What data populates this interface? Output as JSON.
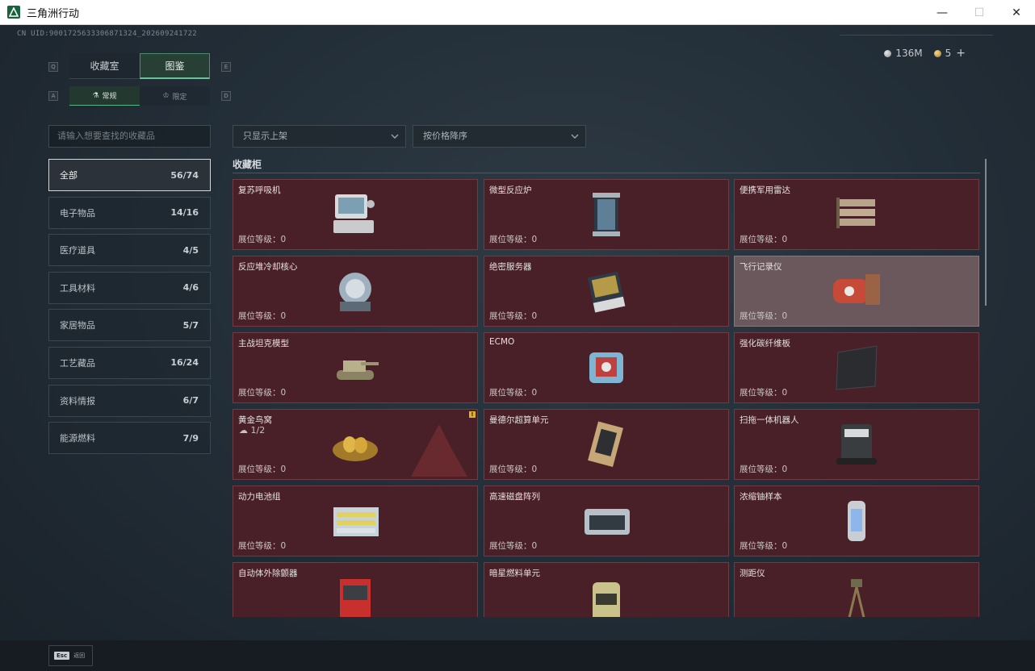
{
  "window": {
    "title": "三角洲行动"
  },
  "header": {
    "uid": "CN UID:9001725633306871324_202609241722",
    "currency": [
      {
        "icon": "silver-coin-icon",
        "value": "136M",
        "color": "#b9bec3"
      },
      {
        "icon": "gold-coin-icon",
        "value": "5",
        "color": "#d4b063"
      }
    ],
    "add_label": "+"
  },
  "keyhints": {
    "q": "Q",
    "e": "E",
    "a": "A",
    "d": "D"
  },
  "tabs": [
    {
      "label": "收藏室",
      "active": false
    },
    {
      "label": "图鉴",
      "active": true
    }
  ],
  "subtabs": [
    {
      "label": "常规",
      "active": true,
      "icon": "flask-icon"
    },
    {
      "label": "限定",
      "active": false,
      "icon": "crown-icon"
    }
  ],
  "search": {
    "placeholder": "请输入想要查找的收藏品"
  },
  "categories": [
    {
      "label": "全部",
      "count": "56/74",
      "active": true
    },
    {
      "label": "电子物品",
      "count": "14/16"
    },
    {
      "label": "医疗道具",
      "count": "4/5"
    },
    {
      "label": "工具材料",
      "count": "4/6"
    },
    {
      "label": "家居物品",
      "count": "5/7"
    },
    {
      "label": "工艺藏品",
      "count": "16/24"
    },
    {
      "label": "资料情报",
      "count": "6/7"
    },
    {
      "label": "能源燃料",
      "count": "7/9"
    }
  ],
  "filters": {
    "shelf": "只显示上架",
    "sort": "按价格降序"
  },
  "section": {
    "title": "收藏柜"
  },
  "items": [
    {
      "name": "复苏呼吸机",
      "level": "展位等级：0",
      "icon": "ventilator-icon"
    },
    {
      "name": "微型反应炉",
      "level": "展位等级：0",
      "icon": "reactor-icon"
    },
    {
      "name": "便携军用雷达",
      "level": "展位等级：0",
      "icon": "radar-icon"
    },
    {
      "name": "反应堆冷却核心",
      "level": "展位等级：0",
      "icon": "cooling-core-icon"
    },
    {
      "name": "绝密服务器",
      "level": "展位等级：0",
      "icon": "server-icon"
    },
    {
      "name": "飞行记录仪",
      "level": "展位等级：0",
      "icon": "flight-recorder-icon",
      "grey": true
    },
    {
      "name": "主战坦克模型",
      "level": "展位等级：0",
      "icon": "tank-model-icon"
    },
    {
      "name": "ECMO",
      "level": "展位等级：0",
      "icon": "ecmo-icon"
    },
    {
      "name": "强化碳纤维板",
      "level": "展位等级：0",
      "icon": "carbon-plate-icon"
    },
    {
      "name": "黄金鸟窝",
      "level": "展位等级：0",
      "icon": "golden-nest-icon",
      "extra": "1/2",
      "warn": "!"
    },
    {
      "name": "曼德尔超算单元",
      "level": "展位等级：0",
      "icon": "supercomputer-icon"
    },
    {
      "name": "扫拖一体机器人",
      "level": "展位等级：0",
      "icon": "mop-robot-icon"
    },
    {
      "name": "动力电池组",
      "level": "展位等级：0",
      "icon": "battery-pack-icon"
    },
    {
      "name": "高速磁盘阵列",
      "level": "展位等级：0",
      "icon": "disk-array-icon"
    },
    {
      "name": "浓缩铀样本",
      "level": "展位等级：0",
      "icon": "uranium-sample-icon"
    },
    {
      "name": "自动体外除颤器",
      "level": "",
      "icon": "defibrillator-icon"
    },
    {
      "name": "暗星燃料单元",
      "level": "",
      "icon": "fuel-cell-icon"
    },
    {
      "name": "测距仪",
      "level": "",
      "icon": "rangefinder-icon"
    }
  ],
  "footer": {
    "esc_key": "Esc",
    "esc_label": "返回"
  }
}
